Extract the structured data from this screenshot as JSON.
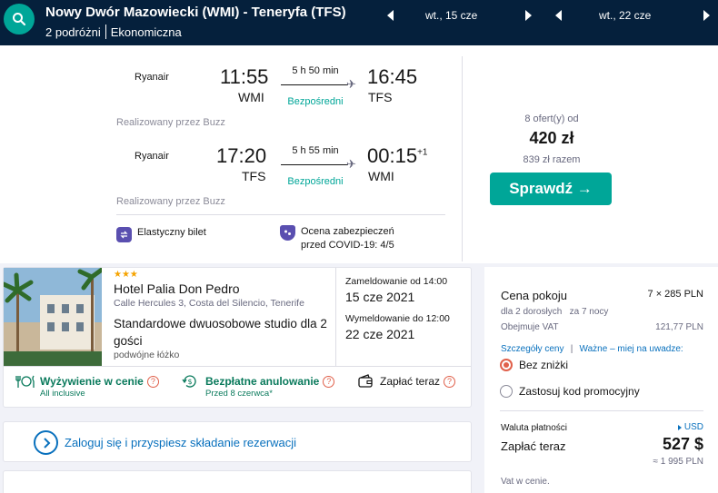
{
  "header": {
    "route": "Nowy Dwór Mazowiecki (WMI) - Teneryfa (TFS)",
    "travellers": "2 podróżni",
    "cabin": "Ekonomiczna",
    "outbound_date": "wt., 15 cze",
    "return_date": "wt., 22 cze"
  },
  "flights": {
    "outbound": {
      "airline": "Ryanair",
      "dep_time": "11:55",
      "dep_code": "WMI",
      "duration": "5 h 50 min",
      "stops": "Bezpośredni",
      "arr_time": "16:45",
      "arr_code": "TFS",
      "operated": "Realizowany przez Buzz"
    },
    "inbound": {
      "airline": "Ryanair",
      "dep_time": "17:20",
      "dep_code": "TFS",
      "duration": "5 h 55 min",
      "stops": "Bezpośredni",
      "arr_time": "00:15",
      "arr_offset": "+1",
      "arr_code": "WMI",
      "operated": "Realizowany przez Buzz"
    },
    "features": {
      "flexible": "Elastyczny bilet",
      "covid_line1": "Ocena zabezpieczeń",
      "covid_line2": "przed COVID-19: 4/5"
    },
    "offers": {
      "count": "8 ofert(y) od",
      "price": "420 zł",
      "total": "839 zł razem",
      "button": "Sprawdź →"
    }
  },
  "hotel": {
    "stars": "★★★",
    "name": "Hotel Palia Don Pedro",
    "address": "Calle Hercules 3, Costa del Silencio, Tenerife",
    "room_type": "Standardowe dwuosobowe studio dla 2 gości",
    "bed": "podwójne łóżko",
    "checkin_label": "Zameldowanie od 14:00",
    "checkin_date": "15 cze 2021",
    "checkout_label": "Wymeldowanie do 12:00",
    "checkout_date": "22 cze 2021",
    "meal_label": "Wyżywienie w cenie",
    "meal_sub": "All inclusive",
    "cancel_label": "Bezpłatne anulowanie",
    "cancel_sub": "Przed 8 czerwca*",
    "pay_label": "Zapłać teraz",
    "qmark": "?"
  },
  "login": {
    "text": "Zaloguj się i przyspiesz składanie rezerwacji"
  },
  "pricing": {
    "room_price_label": "Cena pokoju",
    "room_price_value": "7 × 285 PLN",
    "guests": "dla 2 dorosłych",
    "nights": "za 7 nocy",
    "vat_label": "Obejmuje VAT",
    "vat_value": "121,77 PLN",
    "details_link": "Szczegóły ceny",
    "note_link": "Ważne – miej na uwadze:",
    "radio_no_discount": "Bez zniżki",
    "radio_promo": "Zastosuj kod promocyjny",
    "currency_label": "Waluta płatności",
    "currency_value": "USD",
    "pay_now": "Zapłać teraz",
    "pay_value": "527 $",
    "pay_pln": "≈ 1 995 PLN",
    "vat_note": "Vat w cenie."
  },
  "colors": {
    "header_bg": "#05203c",
    "accent_teal": "#00a698",
    "link_blue": "#0870bd",
    "promo_red": "#e0604a",
    "feature_purple": "#5a4fb0"
  }
}
